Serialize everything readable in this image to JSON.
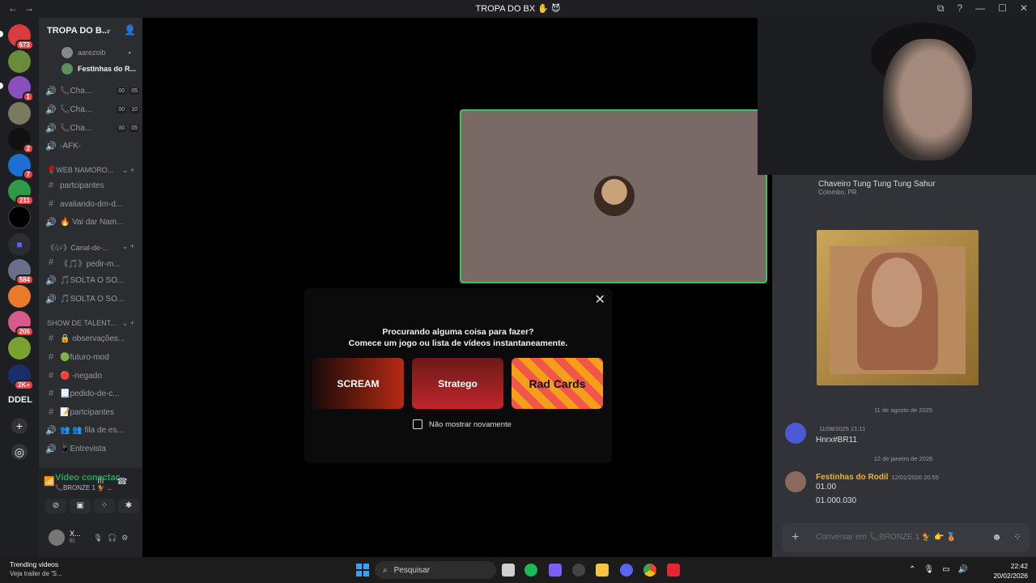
{
  "window": {
    "title": "TROPA DO BX ✋ 😈"
  },
  "servers": {
    "badges": [
      "673",
      "1",
      "2",
      "7",
      "211",
      "584",
      "206",
      "2K+"
    ],
    "ddel_label": "DDEL"
  },
  "sidebar": {
    "server_name": "TROPA DO B...",
    "voice_users": [
      {
        "name": "aarezoib"
      },
      {
        "name": "Festinhas do R..."
      }
    ],
    "top_channels": [
      {
        "name": "📞Cha...",
        "count_a": "00",
        "count_b": "05"
      },
      {
        "name": "📞Cha...",
        "count_a": "00",
        "count_b": "10"
      },
      {
        "name": "📞Cha...",
        "count_a": "00",
        "count_b": "05"
      },
      {
        "name": "-AFK-"
      }
    ],
    "categories": [
      {
        "name": "🌹WEB NAMORO...",
        "channels": [
          {
            "name": "partcipantes",
            "type": "text"
          },
          {
            "name": "avaliando-dm-d...",
            "type": "text"
          },
          {
            "name": "🔥 Vai dar Nam...",
            "type": "voice"
          }
        ]
      },
      {
        "name": "《🎶》Canal-de-...",
        "channels": [
          {
            "name": "《🎵》pedir-m...",
            "type": "text"
          },
          {
            "name": "🎵SOLTA O SO...",
            "type": "voice"
          },
          {
            "name": "🎵SOLTA O SO...",
            "type": "voice"
          }
        ]
      },
      {
        "name": "SHOW DE TALENT...",
        "channels": [
          {
            "name": "🔒 observações...",
            "type": "text"
          },
          {
            "name": "🟢futuro-mod",
            "type": "text"
          },
          {
            "name": "🔴 -negado",
            "type": "text"
          },
          {
            "name": "📃pedido-de-c...",
            "type": "text"
          },
          {
            "name": "📝partcipantes",
            "type": "text"
          },
          {
            "name": "👥 👥 fila de es...",
            "type": "voice"
          },
          {
            "name": "📱Entrevista",
            "type": "voice"
          }
        ]
      }
    ]
  },
  "voice_panel": {
    "status": "Vídeo conectac",
    "channel": "📞BRONZE 1 🐓 ...",
    "user_name": "X...",
    "user_status": "Ei"
  },
  "activity_modal": {
    "line1": "Procurando alguma coisa para fazer?",
    "line2": "Comece um jogo ou lista de vídeos instantaneamente.",
    "cards": [
      "SCREAM",
      "Stratego",
      "Rad Cards"
    ],
    "checkbox_label": "Não mostrar novamente"
  },
  "chat": {
    "embed": {
      "author": "Chaveiro Tung Tung Tung Sahur",
      "location": "Colombo, PR"
    },
    "divider1": "11 de agosto de 2025",
    "msg1": {
      "time": "11/08/2025 21:11",
      "text": "Hnrx#BR11"
    },
    "divider2": "12 de janeiro de 2026",
    "msg2": {
      "author": "Festinhas do Rodil",
      "time": "12/01/2026 20:55",
      "line1": "01.00",
      "line2": "01.000.030"
    },
    "composer_placeholder": "Conversar em 📞BRONZE 1 🐓 👉 🥉"
  },
  "taskbar": {
    "news_title": "Trending videos",
    "news_sub": "Veja trailer de 'S...",
    "search": "Pesquisar",
    "time": "22:42",
    "date": "20/02/2026"
  },
  "colors": {
    "accent_green": "#23a55a",
    "badge_red": "#f23f43",
    "author_gold": "#f0b232"
  }
}
